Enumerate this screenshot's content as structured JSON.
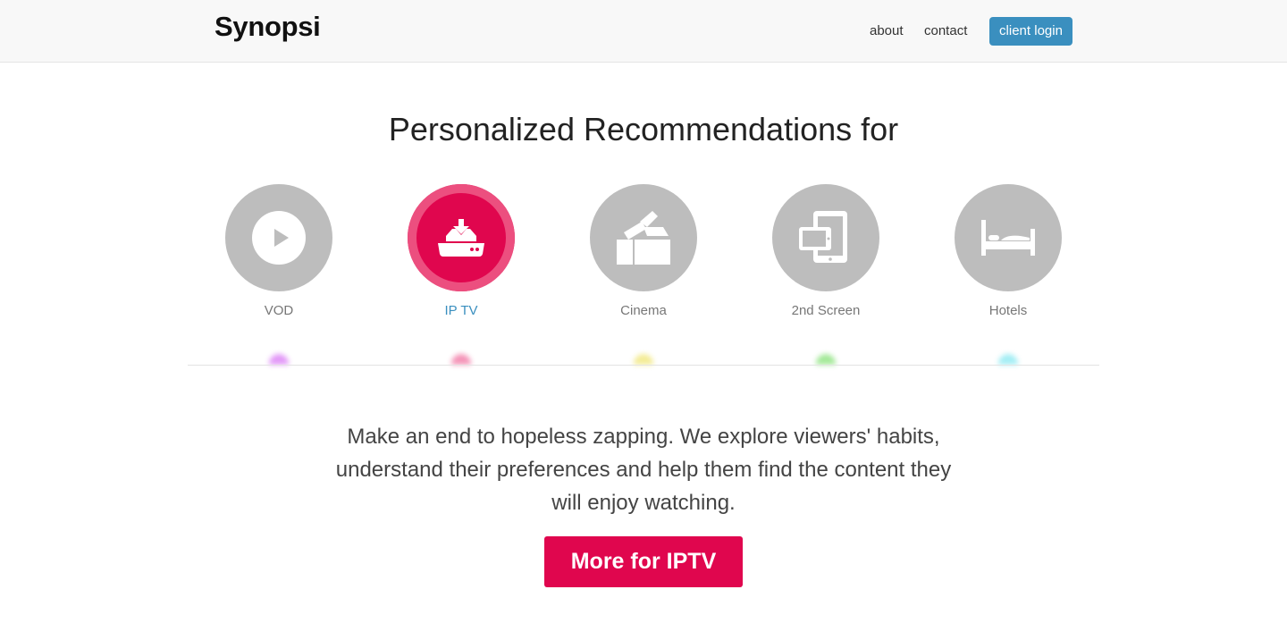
{
  "header": {
    "logo": "Synopsi",
    "nav": {
      "about": "about",
      "contact": "contact",
      "login": "client login"
    }
  },
  "hero": {
    "headline": "Personalized Recommendations for",
    "categories": [
      {
        "label": "VOD",
        "icon": "play-icon",
        "active": false
      },
      {
        "label": "IP TV",
        "icon": "set-top-box-icon",
        "active": true
      },
      {
        "label": "Cinema",
        "icon": "clapperboard-icon",
        "active": false
      },
      {
        "label": "2nd Screen",
        "icon": "devices-icon",
        "active": false
      },
      {
        "label": "Hotels",
        "icon": "bed-icon",
        "active": false
      }
    ],
    "lead": "Make an end to hopeless zapping. We explore viewers' habits, understand their preferences and help them find the content they will enjoy watching.",
    "cta": "More for IPTV"
  },
  "colors": {
    "accent": "#e0064e",
    "link": "#3a8fbf",
    "inactive": "#bdbdbd",
    "glows": [
      "#d76ef5",
      "#f0679a",
      "#efe46b",
      "#7ee06e",
      "#7ee7f0"
    ]
  }
}
